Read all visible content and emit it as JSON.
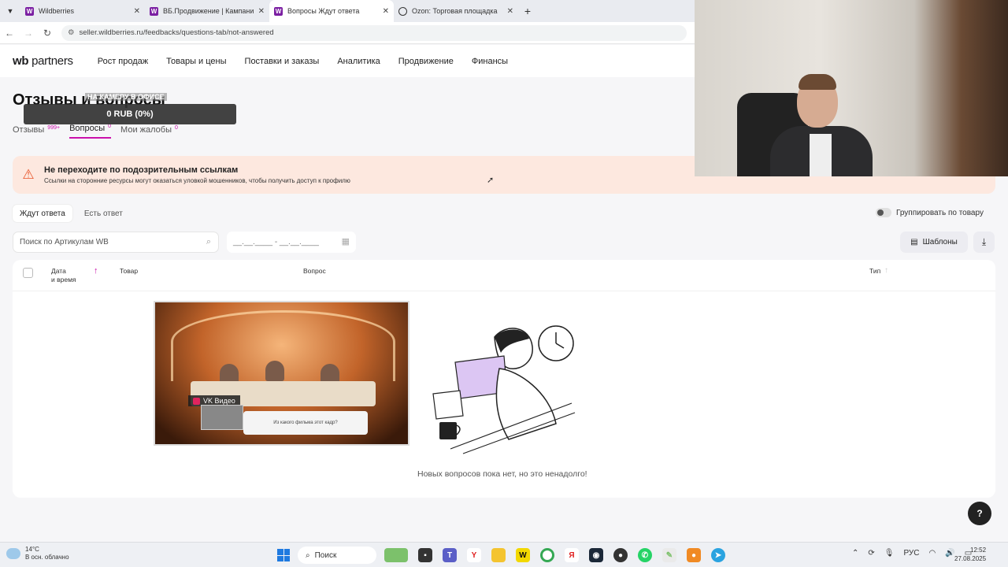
{
  "browser": {
    "tabs": [
      {
        "title": "Wildberries",
        "icon": "wildberries-favicon",
        "active": false
      },
      {
        "title": "ВБ.Продвижение | Кампании",
        "icon": "wildberries-favicon",
        "active": false
      },
      {
        "title": "Вопросы Ждут ответа",
        "icon": "wildberries-favicon",
        "active": true
      },
      {
        "title": "Ozon: Торговая площадка",
        "icon": "ozon-favicon",
        "active": false
      }
    ],
    "url": "seller.wildberries.ru/feedbacks/questions-tab/not-answered"
  },
  "header": {
    "logo_wb": "wb",
    "logo_text": " partners",
    "menu": [
      "Рост продаж",
      "Товары и цены",
      "Поставки и заказы",
      "Аналитика",
      "Продвижение",
      "Финансы"
    ]
  },
  "page": {
    "title": "Отзывы и вопросы",
    "subtabs": [
      {
        "label": "Отзывы",
        "badge": "999+"
      },
      {
        "label": "Вопросы",
        "badge": "0"
      },
      {
        "label": "Мои жалобы",
        "badge": "0"
      }
    ]
  },
  "overlay": {
    "camera_label": "НА КАМЕРУ В ОФИСЕ",
    "balance": "0 RUB (0%)"
  },
  "alert": {
    "title": "Не переходите по подозрительным ссылкам",
    "text": "Ссылки на сторонние ресурсы могут оказаться уловкой мошенников, чтобы получить доступ к профилю"
  },
  "filters": {
    "tabs": [
      "Ждут ответа",
      "Есть ответ"
    ],
    "group_label": "Группировать по товару",
    "search_placeholder": "Поиск по Артикулам WB",
    "date_placeholder": "__.__.____ - __.__.____",
    "templates_label": "Шаблоны"
  },
  "table": {
    "col_date": "Дата",
    "col_date_2": "и время",
    "col_goods": "Товар",
    "col_question": "Вопрос",
    "col_type": "Тип"
  },
  "video": {
    "source": "VK Видео",
    "quiz": "Из какого фильма этот кадр?"
  },
  "empty_state": "Новых вопросов пока нет, но это ненадолго!",
  "help_label": "?",
  "taskbar": {
    "temp": "14°C",
    "weather": "В осн. облачно",
    "search": "Поиск",
    "lang": "РУС",
    "time": "12:52",
    "date": "27.08.2025"
  },
  "colors": {
    "accent": "#cb11ab",
    "alert_bg": "#fde8df",
    "alert_icon": "#e8552a"
  }
}
